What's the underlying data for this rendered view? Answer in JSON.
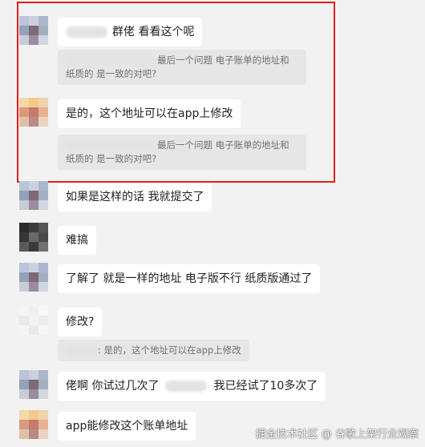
{
  "messages": [
    {
      "text": "群佬 看看这个呢"
    },
    {
      "quote": "最后一个问题 电子账单的地址和纸质的 是一致的对吧?"
    },
    {
      "text": "是的，这个地址可以在app上修改"
    },
    {
      "quote": "最后一个问题 电子账单的地址和纸质的 是一致的对吧?"
    },
    {
      "text": "如果是这样的话 我就提交了"
    },
    {
      "text": "难搞"
    },
    {
      "text": "了解了 就是一样的地址 电子版不行 纸质版通过了"
    },
    {
      "text": "修改?"
    },
    {
      "quote": ": 是的，这个地址可以在app上修改"
    },
    {
      "text_a": "佬啊 你试过几次了",
      "text_b": "我已经试了10多次了"
    },
    {
      "text": "app能修改这个账单地址"
    }
  ],
  "watermark": {
    "text": "掘金技术社区 @ 谷歌上架行业观察"
  },
  "colors": {
    "background": "#f2f2f2",
    "bubble": "#ffffff",
    "quote": "#e6e6e6",
    "highlight_border": "#e02020"
  }
}
